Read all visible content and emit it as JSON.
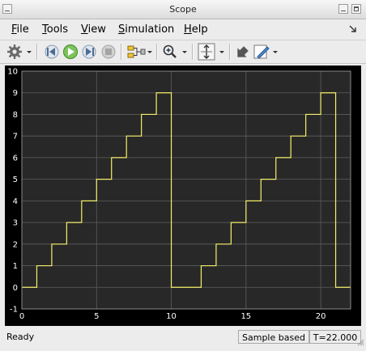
{
  "window": {
    "title": "Scope"
  },
  "menu": [
    {
      "underline": "F",
      "rest": "ile"
    },
    {
      "underline": "T",
      "rest": "ools"
    },
    {
      "underline": "V",
      "rest": "iew"
    },
    {
      "underline": "S",
      "rest": "imulation"
    },
    {
      "underline": "H",
      "rest": "elp"
    }
  ],
  "toolbar": {
    "icons": [
      "settings-gear-icon",
      "step-back-icon",
      "run-icon",
      "step-forward-icon",
      "stop-icon",
      "signal-select-icon",
      "zoom-icon",
      "autoscale-icon",
      "highlight-block-icon",
      "style-pen-icon"
    ]
  },
  "status": {
    "ready": "Ready",
    "mode": "Sample based",
    "time": "T=22.000"
  },
  "colors": {
    "plot_bg": "#000000",
    "axes_bg": "#282828",
    "grid": "#5e5e5e",
    "signal": "#f5f06a",
    "tick_text": "#ffffff"
  },
  "chart_data": {
    "type": "line",
    "title": "",
    "xlabel": "",
    "ylabel": "",
    "xlim": [
      0,
      22
    ],
    "ylim": [
      -1,
      10
    ],
    "xticks": [
      0,
      5,
      10,
      15,
      20
    ],
    "yticks": [
      -1,
      0,
      1,
      2,
      3,
      4,
      5,
      6,
      7,
      8,
      9,
      10
    ],
    "grid": true,
    "series": [
      {
        "name": "",
        "x": [
          0,
          1,
          1,
          2,
          2,
          3,
          3,
          4,
          4,
          5,
          5,
          6,
          6,
          7,
          7,
          8,
          8,
          9,
          9,
          10,
          10,
          12,
          12,
          13,
          13,
          14,
          14,
          15,
          15,
          16,
          16,
          17,
          17,
          18,
          18,
          19,
          19,
          20,
          20,
          21,
          21,
          22
        ],
        "y": [
          0,
          0,
          1,
          1,
          2,
          2,
          3,
          3,
          4,
          4,
          5,
          5,
          6,
          6,
          7,
          7,
          8,
          8,
          9,
          9,
          0,
          0,
          1,
          1,
          2,
          2,
          3,
          3,
          4,
          4,
          5,
          5,
          6,
          6,
          7,
          7,
          8,
          8,
          9,
          9,
          0,
          0
        ]
      }
    ]
  }
}
